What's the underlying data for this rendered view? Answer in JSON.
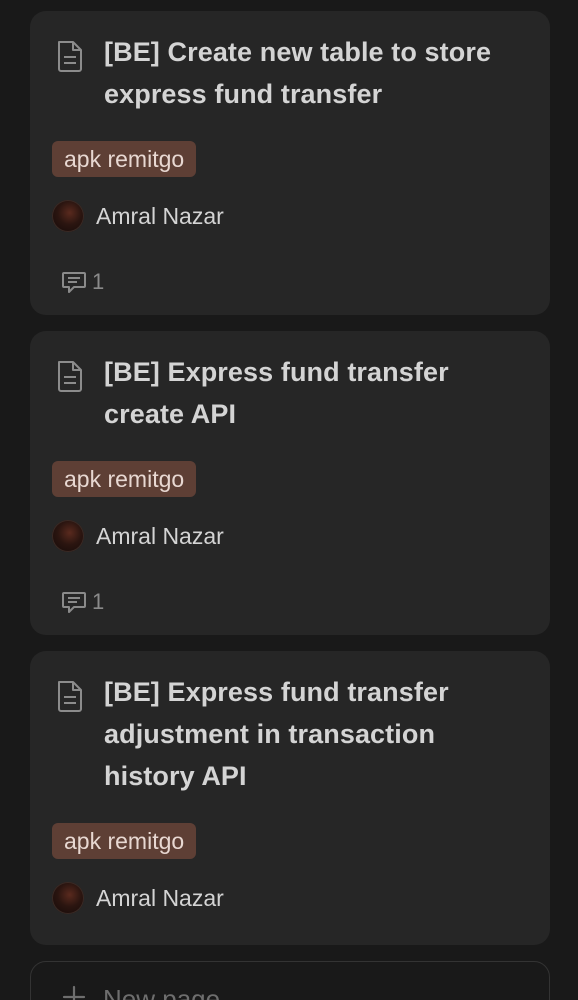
{
  "cards": [
    {
      "title": "[BE] Create new table to store express fund transfer",
      "tag": "apk remitgo",
      "assignee": "Amral Nazar",
      "comment_count": "1"
    },
    {
      "title": "[BE] Express fund transfer create API",
      "tag": "apk remitgo",
      "assignee": "Amral Nazar",
      "comment_count": "1"
    },
    {
      "title": "[BE] Express fund transfer adjustment in transaction history API",
      "tag": "apk remitgo",
      "assignee": "Amral Nazar"
    }
  ],
  "new_page": {
    "label": "New page",
    "icon": "plus-icon"
  },
  "colors": {
    "background": "#191919",
    "card": "#262626",
    "tag_bg": "#5e3f35",
    "tag_text": "#e8d8d2",
    "text": "#d4d4d4",
    "muted": "#8a8a8a"
  },
  "icons": {
    "page": "document-icon",
    "comment": "comment-icon"
  }
}
